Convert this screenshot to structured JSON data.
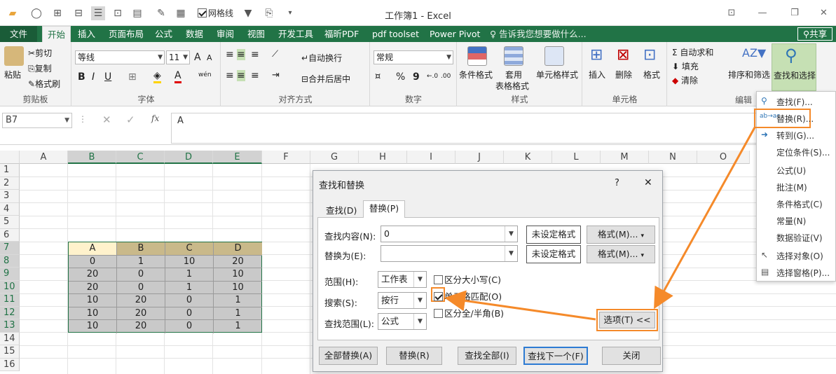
{
  "window": {
    "title": "工作簿1 - Excel",
    "gridlines_label": "网格线"
  },
  "tabs": [
    "文件",
    "开始",
    "插入",
    "页面布局",
    "公式",
    "数据",
    "审阅",
    "视图",
    "开发工具",
    "福昕PDF",
    "pdf toolset",
    "Power Pivot"
  ],
  "tell_me": "告诉我您想要做什么...",
  "share": "共享",
  "ribbon": {
    "clipboard": {
      "paste": "粘贴",
      "cut": "剪切",
      "copy": "复制",
      "painter": "格式刷",
      "label": "剪贴板"
    },
    "font": {
      "name": "等线",
      "size": "11",
      "bold": "B",
      "italic": "I",
      "underline": "U",
      "grow": "A",
      "shrink": "A",
      "fontcolor": "A",
      "label": "字体",
      "phonetic": "wén"
    },
    "align": {
      "wrap": "自动换行",
      "merge": "合并后居中",
      "label": "对齐方式"
    },
    "number": {
      "format": "常规",
      "percent": "%",
      "comma": "9",
      "label": "数字"
    },
    "styles": {
      "cond": "条件格式",
      "table": "套用",
      "table2": "表格格式",
      "cell": "单元格样式",
      "label": "样式"
    },
    "cells": {
      "insert": "插入",
      "delete": "删除",
      "format": "格式",
      "label": "单元格"
    },
    "editing": {
      "autosum": "自动求和",
      "fill": "填充",
      "clear": "清除",
      "sort": "排序和筛选",
      "find": "查找和选择",
      "label": "编辑"
    }
  },
  "namebox": "B7",
  "formula": "A",
  "columns": [
    "A",
    "B",
    "C",
    "D",
    "E",
    "F",
    "G",
    "H",
    "I",
    "J",
    "K",
    "L",
    "M",
    "N",
    "O"
  ],
  "rows": [
    "1",
    "2",
    "3",
    "4",
    "5",
    "6",
    "7",
    "8",
    "9",
    "10",
    "11",
    "12",
    "13",
    "14",
    "15",
    "16"
  ],
  "table": [
    [
      "A",
      "B",
      "C",
      "D"
    ],
    [
      "0",
      "1",
      "10",
      "20"
    ],
    [
      "20",
      "0",
      "1",
      "10"
    ],
    [
      "20",
      "0",
      "1",
      "10"
    ],
    [
      "10",
      "20",
      "0",
      "1"
    ],
    [
      "10",
      "20",
      "0",
      "1"
    ],
    [
      "10",
      "20",
      "0",
      "1"
    ]
  ],
  "dialog": {
    "title": "查找和替换",
    "help": "?",
    "close": "✕",
    "tab_find": "查找(D)",
    "tab_replace": "替换(P)",
    "find_label": "查找内容(N):",
    "find_value": "0",
    "replace_label": "替换为(E):",
    "replace_value": "",
    "no_format": "未设定格式",
    "format_btn": "格式(M)...",
    "scope_label": "范围(H):",
    "scope_value": "工作表",
    "search_label": "搜索(S):",
    "search_value": "按行",
    "lookin_label": "查找范围(L):",
    "lookin_value": "公式",
    "case": "区分大小写(C)",
    "whole": "单元格匹配(O)",
    "width": "区分全/半角(B)",
    "options": "选项(T) <<",
    "replace_all": "全部替换(A)",
    "replace": "替换(R)",
    "find_all": "查找全部(I)",
    "find_next": "查找下一个(F)",
    "close_btn": "关闭"
  },
  "menu": [
    "查找(F)...",
    "替换(R)...",
    "转到(G)...",
    "定位条件(S)...",
    "公式(U)",
    "批注(M)",
    "条件格式(C)",
    "常量(N)",
    "数据验证(V)",
    "选择对象(O)",
    "选择窗格(P)..."
  ],
  "colors": {
    "excel_green": "#217346",
    "highlight": "#f58a2a",
    "table_header": "#fff2cc",
    "table_body": "#c9c9c9"
  }
}
